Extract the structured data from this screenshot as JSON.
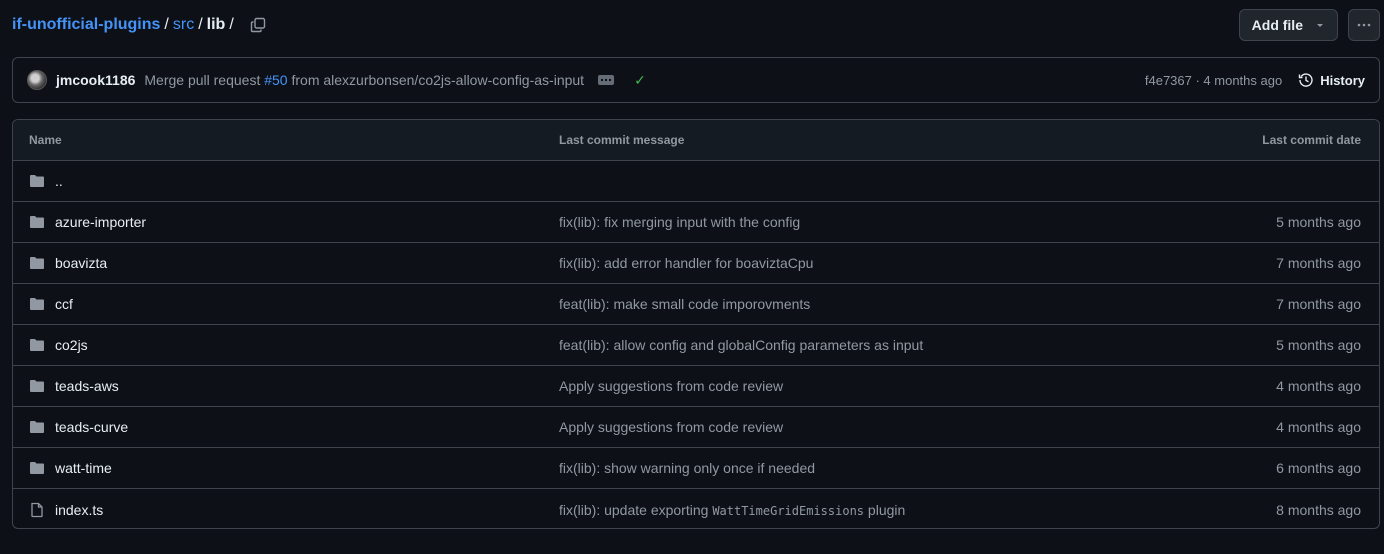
{
  "breadcrumb": {
    "repo": "if-unofficial-plugins",
    "folder1": "src",
    "current": "lib",
    "sep": "/"
  },
  "actions": {
    "add_file": "Add file",
    "more": "···"
  },
  "latest_commit": {
    "author": "jmcook1186",
    "message_prefix": "Merge pull request ",
    "pr": "#50",
    "message_suffix": " from alexzurbonsen/co2js-allow-config-as-input",
    "status": "✓",
    "sha_time": "f4e7367 · 4 months ago",
    "history_label": "History"
  },
  "table": {
    "headers": {
      "name": "Name",
      "message": "Last commit message",
      "date": "Last commit date"
    },
    "parent": "..",
    "rows": [
      {
        "name": "azure-importer",
        "type": "folder",
        "message": "fix(lib): fix merging input with the config",
        "date": "5 months ago"
      },
      {
        "name": "boavizta",
        "type": "folder",
        "message": "fix(lib): add error handler for boaviztaCpu",
        "date": "7 months ago"
      },
      {
        "name": "ccf",
        "type": "folder",
        "message": "feat(lib): make small code imporovments",
        "date": "7 months ago"
      },
      {
        "name": "co2js",
        "type": "folder",
        "message": "feat(lib): allow config and globalConfig parameters as input",
        "date": "5 months ago"
      },
      {
        "name": "teads-aws",
        "type": "folder",
        "message": "Apply suggestions from code review",
        "date": "4 months ago"
      },
      {
        "name": "teads-curve",
        "type": "folder",
        "message": "Apply suggestions from code review",
        "date": "4 months ago"
      },
      {
        "name": "watt-time",
        "type": "folder",
        "message": "fix(lib): show warning only once if needed",
        "date": "6 months ago"
      },
      {
        "name": "index.ts",
        "type": "file",
        "message_prefix": "fix(lib): update exporting ",
        "message_code": "WattTimeGridEmissions",
        "message_suffix": " plugin",
        "date": "8 months ago"
      }
    ]
  },
  "colors": {
    "background": "#0d1117",
    "border": "#3d444d",
    "link": "#4493f8",
    "muted": "#9198a1",
    "success": "#3fb950"
  }
}
